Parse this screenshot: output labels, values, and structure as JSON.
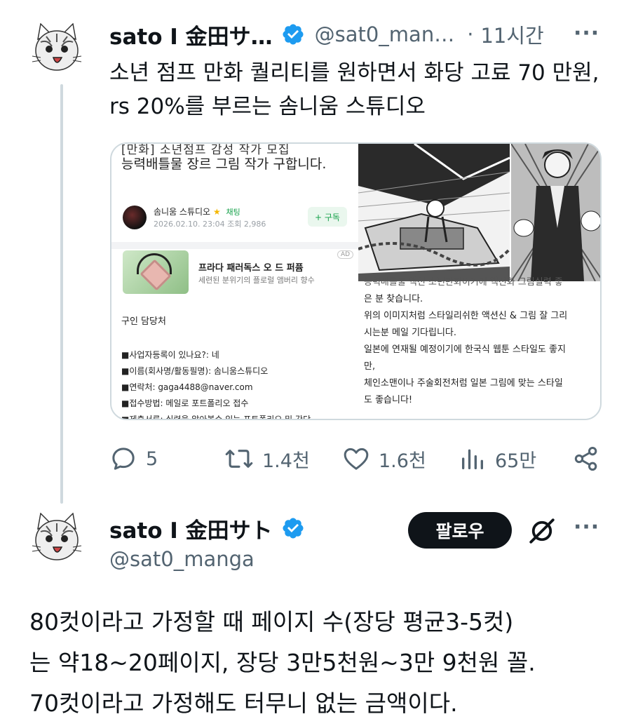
{
  "tweet1": {
    "author_name": "sato I 金田サ…",
    "handle": "@sat0_man…",
    "separator": "·",
    "time": "11시간",
    "text": "소년 점프 만화 퀄리티를 원하면서 화당 고료 70 만원, rs 20%를 부르는 솜니움 스튜디오",
    "media": {
      "post_title_cut": "[만화] 소년점프 감성 작가 모집",
      "post_title": "능력배틀물 장르 그림 작가 구합니다.",
      "studio_name": "솜니움 스튜디오",
      "chat_label": "채팅",
      "post_meta": "2026.02.10. 23:04 조회 2,986",
      "follow_chip": "+ 구독",
      "ad_title": "프라다 패러독스 오 드 퍼퓸",
      "ad_subtitle": "세련된 분위기의 플로럴 앰버리 향수",
      "ad_tag": "AD",
      "recruit_title": "구인 담당처",
      "recruit_rows": [
        "■사업자등록이 있나요?:  네",
        "■이름(회사명/활동필명): 솜니움스튜디오",
        "■연락처: gaga4488@naver.com",
        "■접수방법:  메일로 포트폴리오 접수",
        "■제출서류:  실력을 알아볼수 있는 포트폴리오 및 간단"
      ],
      "right_cut": "능력배틀물 액션 소년만화이기에 액션화 그림실력 좋",
      "right_lines": [
        "은 분 찾습니다.",
        "위의 이미지처럼 스타일리쉬한 액션신 & 그림 잘 그리",
        "시는분 메일 기다립니다.",
        "일본에 연재될 예정이기에 한국식 웹툰 스타일도 좋지",
        "만,",
        "체인소맨이나 주술회전처럼 일본 그림에 맞는 스타일",
        "도 좋습니다!"
      ]
    },
    "actions": {
      "replies": "5",
      "retweets": "1.4천",
      "likes": "1.6천",
      "views": "65만"
    }
  },
  "tweet2": {
    "author_name": "sato I 金田サト",
    "handle": "@sat0_manga",
    "follow_label": "팔로우",
    "text_lines": [
      "80컷이라고 가정할 때 페이지 수(장당 평균3-5컷)",
      "는 약18~20페이지, 장당 3만5천원~3만 9천원 꼴.",
      "70컷이라고 가정해도 터무니 없는 금액이다."
    ]
  },
  "icons": {
    "verified": "verified-badge-icon",
    "more": "more-dots-icon",
    "reply": "reply-icon",
    "retweet": "retweet-icon",
    "like": "heart-icon",
    "views": "views-bar-icon",
    "share": "share-icon",
    "grok": "grok-icon"
  },
  "colors": {
    "verified": "#1d9bf0",
    "text": "#0f1419",
    "secondary": "#536471",
    "border": "#cfd9de",
    "follow_button": "#0f1419"
  }
}
